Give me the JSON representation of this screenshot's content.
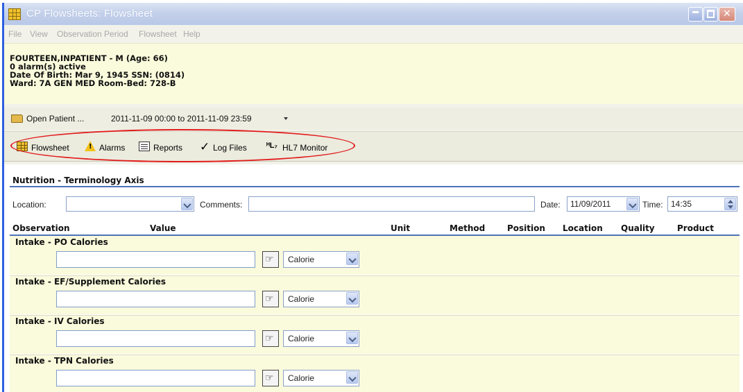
{
  "window": {
    "title": "CP Flowsheets: Flowsheet",
    "controls": {
      "minimize": "_",
      "maximize": "□",
      "close": "✕"
    }
  },
  "menu": [
    "File",
    "View",
    "Observation Period",
    "Flowsheet",
    "Help"
  ],
  "patient": {
    "name_line": "FOURTEEN,INPATIENT - M (Age: 66)",
    "alarm_line": "0 alarm(s) active",
    "dob_line": "Date Of Birth: Mar 9, 1945  SSN: (0814)",
    "ward_line": "Ward: 7A GEN MED  Room-Bed: 728-B"
  },
  "open_bar": {
    "open_patient": "Open Patient ...",
    "period": "2011-11-09 00:00 to 2011-11-09 23:59"
  },
  "toolbar": {
    "flowsheet": "Flowsheet",
    "alarms": "Alarms",
    "reports": "Reports",
    "log_files": "Log Files",
    "hl7_icon": "ᴴL₇",
    "hl7_monitor": "HL7 Monitor"
  },
  "section": {
    "title": "Nutrition - Terminology Axis"
  },
  "filters": {
    "location_label": "Location:",
    "location_value": "",
    "comments_label": "Comments:",
    "comments_value": "",
    "date_label": "Date:",
    "date_value": "11/09/2011",
    "time_label": "Time:",
    "time_value": "14:35"
  },
  "columns": {
    "observation": "Observation",
    "value": "Value",
    "unit": "Unit",
    "method": "Method",
    "position": "Position",
    "location": "Location",
    "quality": "Quality",
    "product": "Product"
  },
  "observations": [
    {
      "name": "Intake - PO Calories",
      "value": "",
      "unit": "Calorie"
    },
    {
      "name": "Intake - EF/Supplement Calories",
      "value": "",
      "unit": "Calorie"
    },
    {
      "name": "Intake - IV Calories",
      "value": "",
      "unit": "Calorie"
    },
    {
      "name": "Intake - TPN Calories",
      "value": "",
      "unit": "Calorie"
    }
  ],
  "icons": {
    "app": "flowsheet-grid-icon",
    "folder": "folder-icon",
    "warning": "warning-icon",
    "report": "report-icon",
    "check": "checkmark-icon",
    "hand": "hand-pointer-icon"
  },
  "colors": {
    "title_bar": "#c4d1eb",
    "patient_panel": "#fafadc",
    "accent_rule": "#4d73b8",
    "annotation": "#e21b1b"
  }
}
